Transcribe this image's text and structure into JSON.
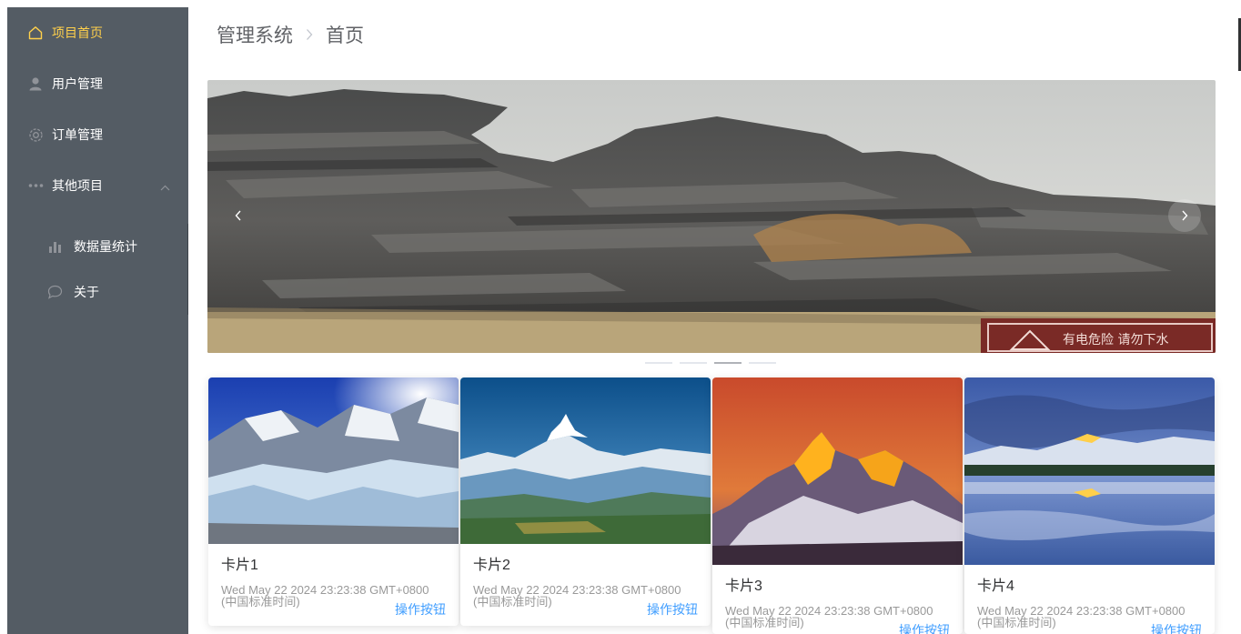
{
  "sidebar": {
    "background_color": "#545c64",
    "active_color": "#ffd04b",
    "items": [
      {
        "label": "项目首页",
        "icon": "home-icon"
      },
      {
        "label": "用户管理",
        "icon": "user-icon"
      },
      {
        "label": "订单管理",
        "icon": "gear-icon"
      },
      {
        "label": "其他项目",
        "icon": "more-icon",
        "expanded": true
      }
    ],
    "submenu": [
      {
        "label": "数据量统计",
        "icon": "bar-chart-icon"
      },
      {
        "label": "关于",
        "icon": "chat-bubble-icon"
      }
    ]
  },
  "breadcrumb": {
    "root": "管理系统",
    "current": "首页"
  },
  "carousel": {
    "slide_count": 4,
    "active_index": 2,
    "sign_text": "有电危险 请勿下水"
  },
  "cards": [
    {
      "title": "卡片1",
      "time": "Wed May 22 2024 23:23:38 GMT+0800 (中国标准时间)",
      "button": "操作按钮"
    },
    {
      "title": "卡片2",
      "time": "Wed May 22 2024 23:23:38 GMT+0800 (中国标准时间)",
      "button": "操作按钮"
    },
    {
      "title": "卡片3",
      "time": "Wed May 22 2024 23:23:38 GMT+0800 (中国标准时间)",
      "button": "操作按钮"
    },
    {
      "title": "卡片4",
      "time": "Wed May 22 2024 23:23:38 GMT+0800 (中国标准时间)",
      "button": "操作按钮"
    }
  ],
  "colors": {
    "link": "#409eff",
    "text_primary": "#303133",
    "text_muted": "#999999"
  }
}
